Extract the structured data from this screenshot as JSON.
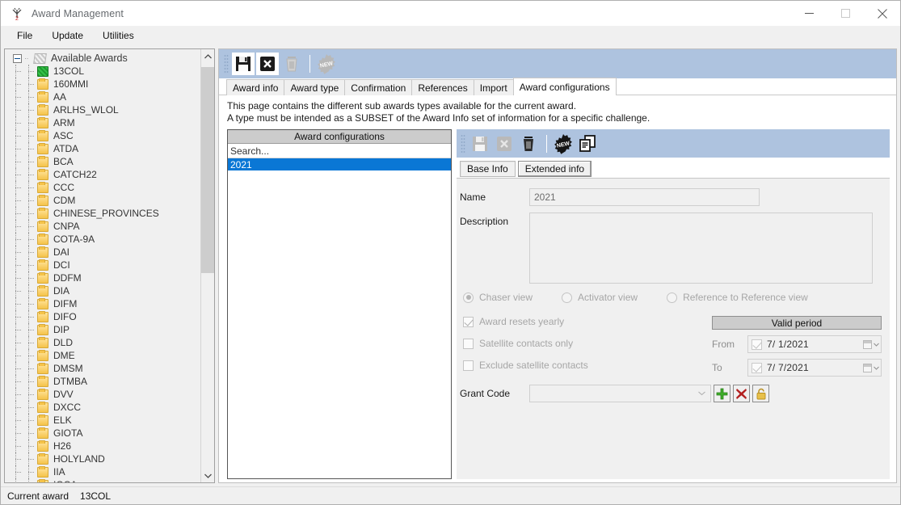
{
  "window": {
    "title": "Award Management",
    "icon": "antenna-icon",
    "controls": {
      "minimize": "—",
      "maximize": "□",
      "close": "✕"
    }
  },
  "menubar": {
    "items": [
      "File",
      "Update",
      "Utilities"
    ]
  },
  "tree": {
    "root": {
      "label": "Available Awards",
      "icon": "awards-stack-icon",
      "expanded": true
    },
    "items": [
      {
        "label": "13COL",
        "icon": "folder-green-icon",
        "current": true
      },
      {
        "label": "160MMI",
        "icon": "folder-icon"
      },
      {
        "label": "AA",
        "icon": "folder-icon"
      },
      {
        "label": "ARLHS_WLOL",
        "icon": "folder-icon"
      },
      {
        "label": "ARM",
        "icon": "folder-icon"
      },
      {
        "label": "ASC",
        "icon": "folder-icon"
      },
      {
        "label": "ATDA",
        "icon": "folder-icon"
      },
      {
        "label": "BCA",
        "icon": "folder-icon"
      },
      {
        "label": "CATCH22",
        "icon": "folder-icon"
      },
      {
        "label": "CCC",
        "icon": "folder-icon"
      },
      {
        "label": "CDM",
        "icon": "folder-icon"
      },
      {
        "label": "CHINESE_PROVINCES",
        "icon": "folder-icon"
      },
      {
        "label": "CNPA",
        "icon": "folder-icon"
      },
      {
        "label": "COTA-9A",
        "icon": "folder-icon"
      },
      {
        "label": "DAI",
        "icon": "folder-icon"
      },
      {
        "label": "DCI",
        "icon": "folder-icon"
      },
      {
        "label": "DDFM",
        "icon": "folder-icon"
      },
      {
        "label": "DIA",
        "icon": "folder-icon"
      },
      {
        "label": "DIFM",
        "icon": "folder-icon"
      },
      {
        "label": "DIFO",
        "icon": "folder-icon"
      },
      {
        "label": "DIP",
        "icon": "folder-icon"
      },
      {
        "label": "DLD",
        "icon": "folder-icon"
      },
      {
        "label": "DME",
        "icon": "folder-icon"
      },
      {
        "label": "DMSM",
        "icon": "folder-icon"
      },
      {
        "label": "DTMBA",
        "icon": "folder-icon"
      },
      {
        "label": "DVV",
        "icon": "folder-icon"
      },
      {
        "label": "DXCC",
        "icon": "folder-icon"
      },
      {
        "label": "ELK",
        "icon": "folder-icon"
      },
      {
        "label": "GIOTA",
        "icon": "folder-icon"
      },
      {
        "label": "H26",
        "icon": "folder-icon"
      },
      {
        "label": "HOLYLAND",
        "icon": "folder-icon"
      },
      {
        "label": "IIA",
        "icon": "folder-icon"
      },
      {
        "label": "IOCA",
        "icon": "folder-icon"
      }
    ],
    "scrollbar": {
      "up": "ⱏ",
      "down": "ⱟ"
    }
  },
  "main_toolbar": {
    "buttons": [
      {
        "name": "save-button",
        "icon": "floppy-disk-icon",
        "enabled": true
      },
      {
        "name": "cancel-button",
        "icon": "x-box-icon",
        "enabled": true
      },
      {
        "name": "delete-button",
        "icon": "trash-icon",
        "enabled": false
      },
      {
        "name": "new-button",
        "icon": "new-badge-icon",
        "enabled": false,
        "badge_text": "NEW"
      }
    ]
  },
  "tabs": {
    "items": [
      "Award info",
      "Award type",
      "Confirmation",
      "References",
      "Import",
      "Award configurations"
    ],
    "active": "Award configurations"
  },
  "page": {
    "description": "This page contains the different sub awards types available for the current award.\nA type must be intended as a SUBSET of the Award Info set of information for a specific challenge."
  },
  "config_list": {
    "header": "Award configurations",
    "search_placeholder": "Search...",
    "search_value": "",
    "items": [
      {
        "label": "2021",
        "selected": true
      }
    ]
  },
  "sub_toolbar": {
    "buttons": [
      {
        "name": "save-config-button",
        "icon": "floppy-disk-icon",
        "enabled": false
      },
      {
        "name": "cancel-config-button",
        "icon": "x-box-icon",
        "enabled": false
      },
      {
        "name": "delete-config-button",
        "icon": "trash-icon",
        "enabled": true
      },
      {
        "name": "new-config-button",
        "icon": "new-badge-icon",
        "enabled": true,
        "badge_text": "NEW"
      },
      {
        "name": "duplicate-config-button",
        "icon": "copy-documents-icon",
        "enabled": true
      }
    ]
  },
  "sub_tabs": {
    "items": [
      "Base Info",
      "Extended info"
    ],
    "active": "Base Info"
  },
  "form": {
    "name_label": "Name",
    "name_value": "2021",
    "description_label": "Description",
    "description_value": "",
    "views": [
      {
        "label": "Chaser view",
        "selected": true
      },
      {
        "label": "Activator view",
        "selected": false
      },
      {
        "label": "Reference to Reference view",
        "selected": false
      }
    ],
    "checkboxes": [
      {
        "label": "Award resets yearly",
        "checked": true
      },
      {
        "label": "Satellite contacts only",
        "checked": false
      },
      {
        "label": "Exclude satellite contacts",
        "checked": false
      }
    ],
    "valid_period": {
      "title": "Valid period",
      "from_label": "From",
      "from_value": "7/ 1/2021",
      "from_checked": true,
      "to_label": "To",
      "to_value": "7/ 7/2021",
      "to_checked": true
    },
    "grant_code_label": "Grant Code",
    "grant_code_value": "",
    "grant_buttons": [
      {
        "name": "add-grant-code-button",
        "icon": "plus-icon",
        "color": "#3fae2a"
      },
      {
        "name": "delete-grant-code-button",
        "icon": "x-icon",
        "color": "#b32020"
      },
      {
        "name": "lock-grant-code-button",
        "icon": "lock-icon",
        "color": "#e0b53a"
      }
    ]
  },
  "statusbar": {
    "label": "Current award",
    "value": "13COL"
  },
  "colors": {
    "toolbar_blue": "#aec3df",
    "selection_blue": "#0a77d5",
    "panel_grey": "#f0f0f0",
    "header_grey": "#cccccc"
  }
}
